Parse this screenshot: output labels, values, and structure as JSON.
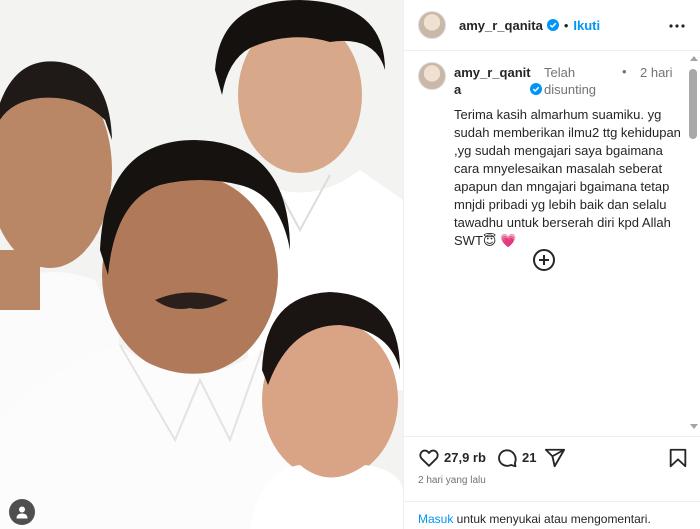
{
  "header": {
    "username": "amy_r_qanita",
    "separator": "•",
    "follow_label": "Ikuti"
  },
  "caption": {
    "username": "amy_r_qanita",
    "edited_label": "Telah disunting",
    "separator": "•",
    "time_ago": "2 hari",
    "text": "Terima kasih almarhum suamiku. yg sudah memberikan ilmu2 ttg kehidupan ,yg sudah mengajari saya bgaimana cara mnyelesaikan masalah seberat apapun dan mngajari bgaimana tetap  mnjdi pribadi yg lebih baik dan selalu tawadhu untuk berserah diri kpd Allah SWT😇 💗"
  },
  "actions": {
    "like_count": "27,9 rb",
    "comment_count": "21"
  },
  "post_date": "2 hari yang lalu",
  "footer": {
    "login_link": "Masuk",
    "login_text": " untuk menyukai atau mengomentari."
  },
  "icons": {
    "verified": "verified-badge-icon",
    "more": "more-options-icon",
    "load_more": "plus-circle-icon",
    "like": "heart-icon",
    "comment": "comment-bubble-icon",
    "share": "paper-plane-icon",
    "save": "bookmark-icon",
    "user_tags": "person-icon"
  },
  "colors": {
    "link_blue": "#0095f6",
    "verified_blue": "#0095f6",
    "muted_text": "#737373",
    "text": "#262626",
    "border": "#efefef"
  }
}
